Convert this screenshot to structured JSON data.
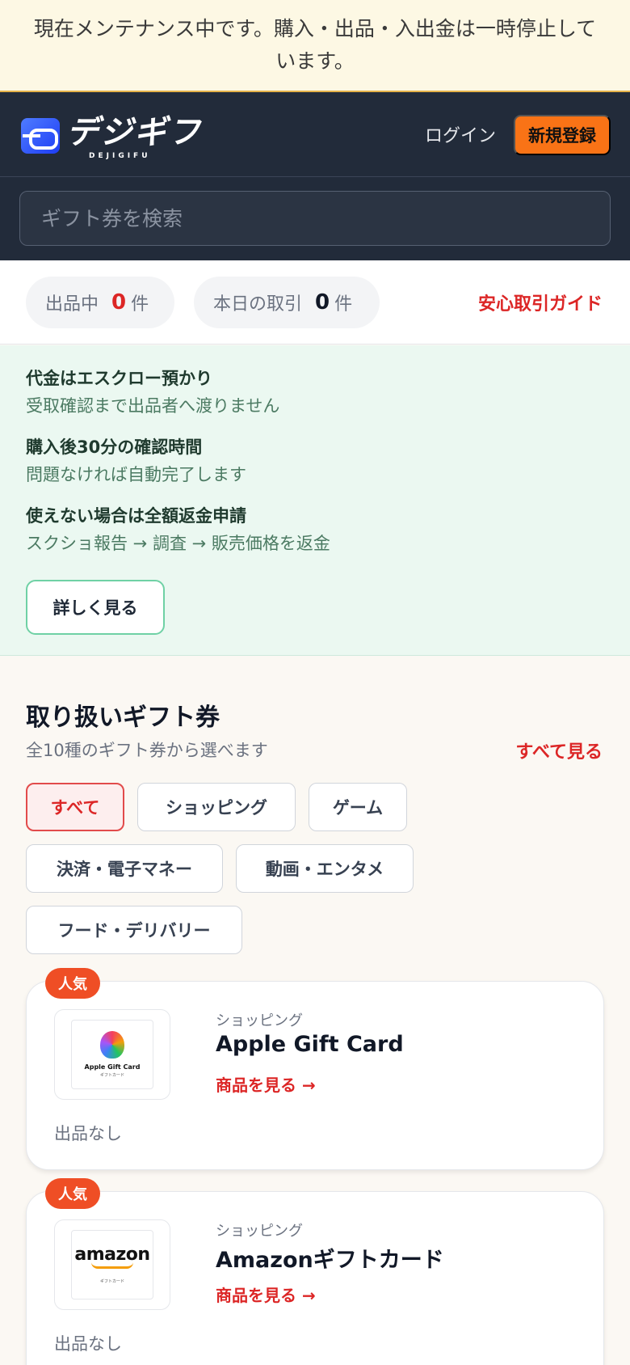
{
  "maintenance": {
    "text": "現在メンテナンス中です。購入・出品・入出金は一時停止しています。"
  },
  "header": {
    "logo_text": "デジギフ",
    "logo_sub": "DEJIGIFU",
    "login_label": "ログイン",
    "signup_label": "新規登録"
  },
  "search": {
    "placeholder": "ギフト券を検索"
  },
  "stats": {
    "listing_label": "出品中",
    "listing_count": "0",
    "listing_unit": "件",
    "today_label": "本日の取引",
    "today_count": "0",
    "today_unit": "件",
    "guide_link": "安心取引ガイド"
  },
  "escrow": {
    "items": [
      {
        "heading": "代金はエスクロー預かり",
        "sub": "受取確認まで出品者へ渡りません"
      },
      {
        "heading": "購入後30分の確認時間",
        "sub": "問題なければ自動完了します"
      },
      {
        "heading": "使えない場合は全額返金申請",
        "sub": "スクショ報告 → 調査 → 販売価格を返金"
      }
    ],
    "detail_button": "詳しく見る"
  },
  "catalog": {
    "title": "取り扱いギフト券",
    "subtitle": "全10種のギフト券から選べます",
    "see_all": "すべて見る",
    "chips": [
      "すべて",
      "ショッピング",
      "ゲーム",
      "決済・電子マネー",
      "動画・エンタメ",
      "フード・デリバリー"
    ],
    "active_chip": "すべて"
  },
  "cards": [
    {
      "badge": "人気",
      "thumb_title": "Apple Gift Card",
      "thumb_sub": "ギフトカード",
      "category": "ショッピング",
      "name": "Apple Gift Card",
      "link": "商品を見る →",
      "status": "出品なし"
    },
    {
      "badge": "人気",
      "thumb_title": "amazon",
      "thumb_sub": "ギフトカード",
      "category": "ショッピング",
      "name": "Amazonギフトカード",
      "link": "商品を見る →",
      "status": "出品なし"
    }
  ],
  "colors": {
    "header_bg": "#222b3a",
    "accent_orange": "#f97316",
    "accent_red": "#dc2626",
    "escrow_bg": "#ebf8f1",
    "maintenance_bg": "#fdf8e4"
  }
}
